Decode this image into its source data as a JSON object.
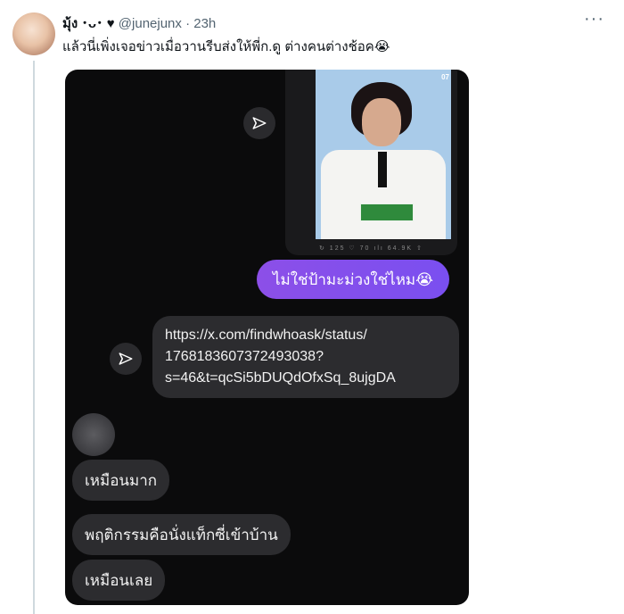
{
  "tweet": {
    "author_name": "มุ้ง ･ᴗ･ ♥",
    "handle": "@junejunx",
    "separator": "·",
    "time": "23h",
    "more": "···",
    "text": "แล้วนี่เพิ่งเจอข่าวเมื่อวานรีบส่งให้พี่ก.ดู ต่างคนต่างช้อค😭"
  },
  "chat": {
    "image_tag": "07",
    "image_stats": "↻ 125   ♡ 70   ılı 64.9K  ⇧",
    "purple_message": "ไม่ใช่ป้ามะม่วงใช่ไหม😭",
    "link_lines": [
      "https://x.com/findwhoask/status/",
      "1768183607372493038?",
      "s=46&t=qcSi5bDUQdOfxSq_8ujgDA"
    ],
    "replies": [
      "เหมือนมาก",
      "พฤติกรรมคือนั่งแท็กซี่เข้าบ้าน",
      "เหมือนเลย"
    ]
  }
}
